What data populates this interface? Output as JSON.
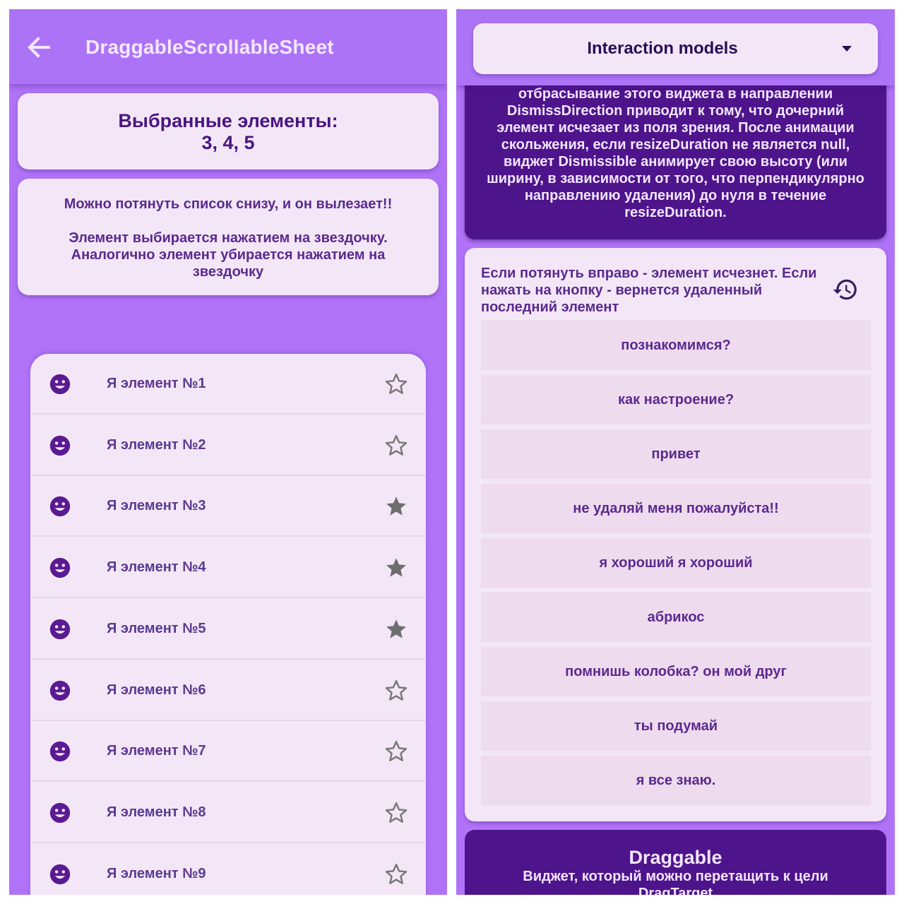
{
  "left": {
    "appbar": {
      "title": "DraggableScrollableSheet",
      "back_icon": "arrow-back-icon"
    },
    "selected": {
      "heading": "Выбранные элементы:",
      "values": "3, 4, 5"
    },
    "info": {
      "line1": "Можно потянуть список снизу, и он вылезает!!",
      "line2": "Элемент выбирается нажатием на звездочку. Аналогично элемент убирается нажатием на звездочку"
    },
    "items": [
      {
        "label": "Я элемент №1",
        "starred": false
      },
      {
        "label": "Я элемент №2",
        "starred": false
      },
      {
        "label": "Я элемент №3",
        "starred": true
      },
      {
        "label": "Я элемент №4",
        "starred": true
      },
      {
        "label": "Я элемент №5",
        "starred": true
      },
      {
        "label": "Я элемент №6",
        "starred": false
      },
      {
        "label": "Я элемент №7",
        "starred": false
      },
      {
        "label": "Я элемент №8",
        "starred": false
      },
      {
        "label": "Я элемент №9",
        "starred": false
      }
    ],
    "item_icon": "smiley-face-icon"
  },
  "right": {
    "dropdown": {
      "selected": "Interaction models",
      "icon": "arrow-drop-down-icon"
    },
    "dismiss_card": {
      "text": "отбрасывание этого виджета в направлении DismissDirection приводит к тому, что дочерний элемент исчезает из поля зрения. После анимации скольжения, если resizeDuration не является null, виджет Dismissible анимирует свою высоту (или ширину, в зависимости от того, что перпендикулярно направлению удаления) до нуля в течение resizeDuration."
    },
    "list_card": {
      "header": "Если потянуть вправо - элемент исчезнет. Если нажать на кнопку - вернется удаленный последний элемент",
      "restore_icon": "restore-history-icon",
      "items": [
        "познакомимся?",
        "как настроение?",
        "привет",
        "не удаляй меня пожалуйста!!",
        "я хороший я хороший",
        "абрикос",
        "помнишь колобка? он мой друг",
        "ты подумай",
        "я все знаю."
      ]
    },
    "drag_card": {
      "title": "Draggable",
      "subtitle": "Виджет, который можно перетащить к цели",
      "subtitle2": "DragTarget"
    }
  },
  "colors": {
    "background": "#b073f8",
    "card": "#f3e7f7",
    "dark_card": "#4e148b",
    "accent_text": "#4a1582",
    "item_bg": "#eedbee"
  }
}
